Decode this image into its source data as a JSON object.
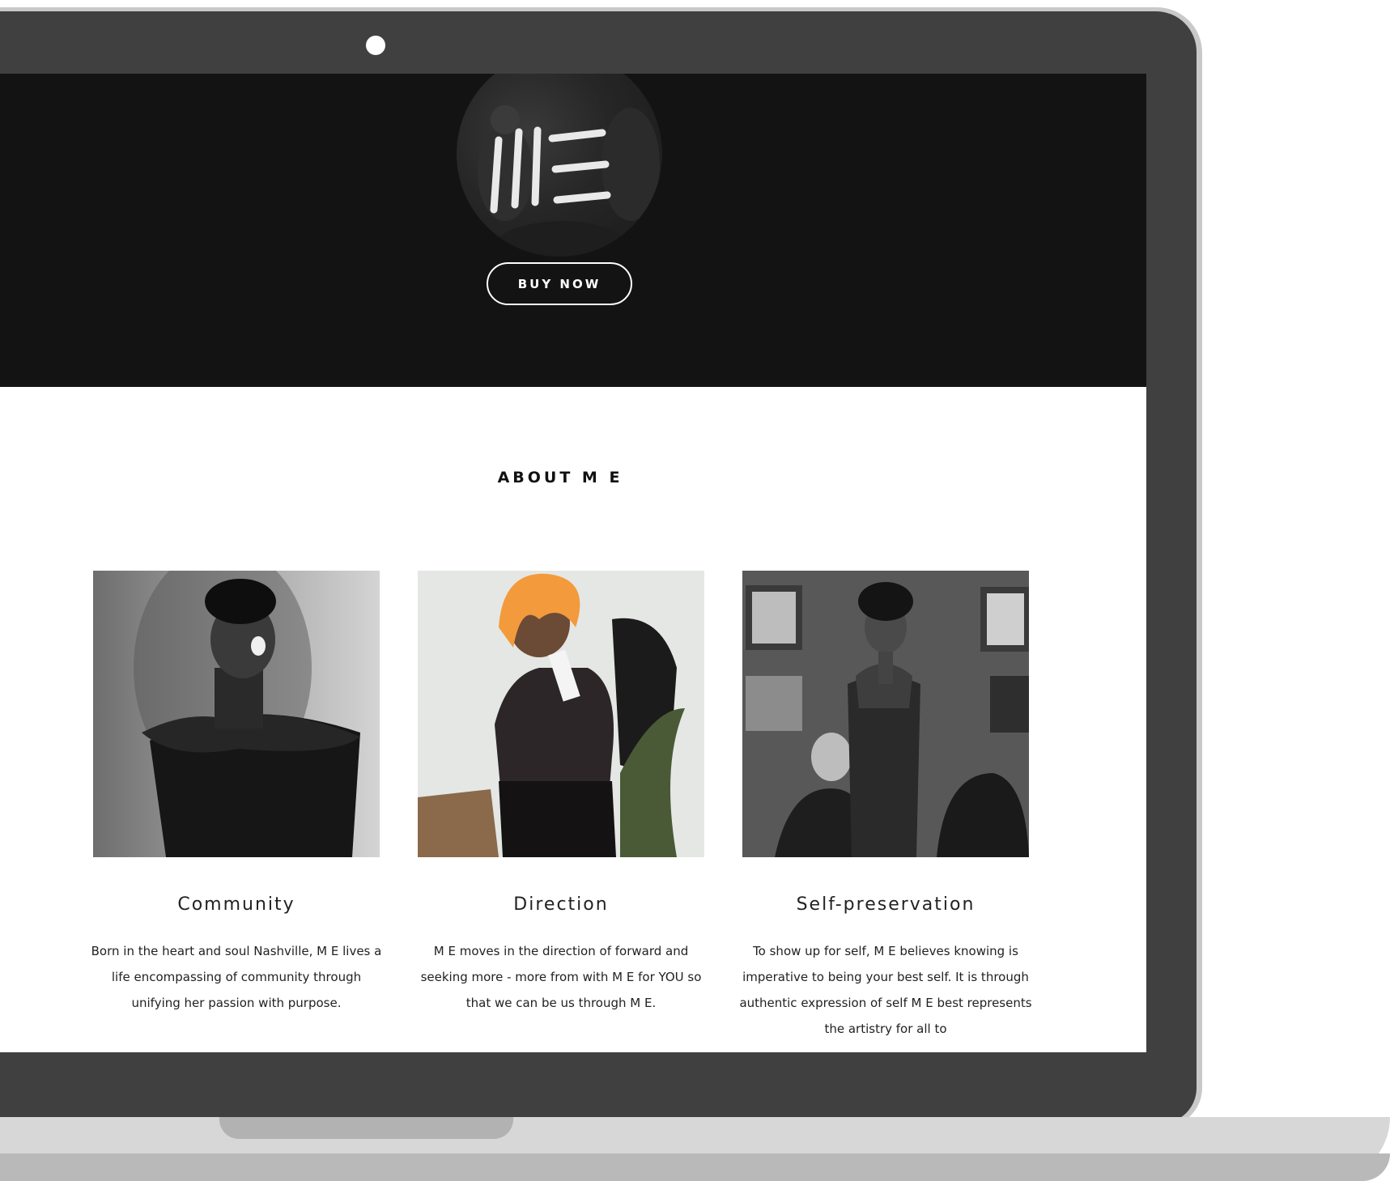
{
  "hero": {
    "logo_text": "ME",
    "buy_button_label": "BUY NOW"
  },
  "about": {
    "title": "ABOUT M E",
    "cards": [
      {
        "title": "Community",
        "text": "Born in the heart and soul Nashville, M E lives a life encompassing of community through unifying her passion with purpose."
      },
      {
        "title": "Direction",
        "text": "M E moves in the direction of forward and seeking more - more from with M E for YOU so that we can be us through M E."
      },
      {
        "title": "Self-preservation",
        "text": "To show up for self, M E believes knowing is imperative to being your best self. It is through authentic expression of self M E best represents the artistry for all to"
      }
    ]
  },
  "colors": {
    "hero_bg": "#131313",
    "laptop_bezel": "#404040",
    "text_dark": "#222222"
  }
}
